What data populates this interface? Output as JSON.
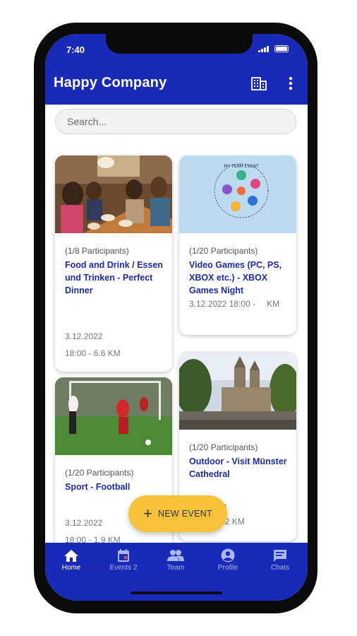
{
  "status_bar": {
    "time": "7:40"
  },
  "app_bar": {
    "title": "Happy Company",
    "org_icon": "building-icon",
    "menu_icon": "more-vert-icon"
  },
  "search": {
    "placeholder": "Search..."
  },
  "events": [
    {
      "participants": "(1/8 Participants)",
      "title": "Food and Drink / Essen und Trinken - Perfect Dinner",
      "date": "3.12.2022",
      "details": "18:00 - 6.6 KM",
      "image": "group-dinner-photo"
    },
    {
      "participants": "(1/20 Participants)",
      "title": "Video Games (PC, PS, XBOX etc.) - XBOX Games Night",
      "date": "3.12.2022 18:00 -",
      "details": "KM",
      "image": "my-team-event-logo",
      "logo_text": "MY TEAM EVENT"
    },
    {
      "participants": "(1/20 Participants)",
      "title": "Sport - Football",
      "date": "3.12.2022",
      "details": "18:00 - 1.9 KM",
      "image": "football-match-photo"
    },
    {
      "participants": "(1/20 Participants)",
      "title": "Outdoor - Visit Münster Cathedral",
      "date": "3.12.2022",
      "details": "18:00 - 0.2 KM",
      "image": "cathedral-photo"
    }
  ],
  "fab": {
    "label": "NEW EVENT",
    "icon": "plus-icon"
  },
  "bottom_nav": [
    {
      "label": "Home",
      "icon": "home-icon",
      "active": true
    },
    {
      "label": "Events 2",
      "icon": "calendar-icon",
      "active": false
    },
    {
      "label": "Team",
      "icon": "team-icon",
      "active": false
    },
    {
      "label": "Profile",
      "icon": "account-icon",
      "active": false
    },
    {
      "label": "Chats",
      "icon": "chat-icon",
      "active": false
    }
  ],
  "colors": {
    "primary": "#1a2ab8",
    "accent": "#f6c23a",
    "inactive_nav": "#a9b6f7",
    "title_text": "#1a2ab8"
  }
}
